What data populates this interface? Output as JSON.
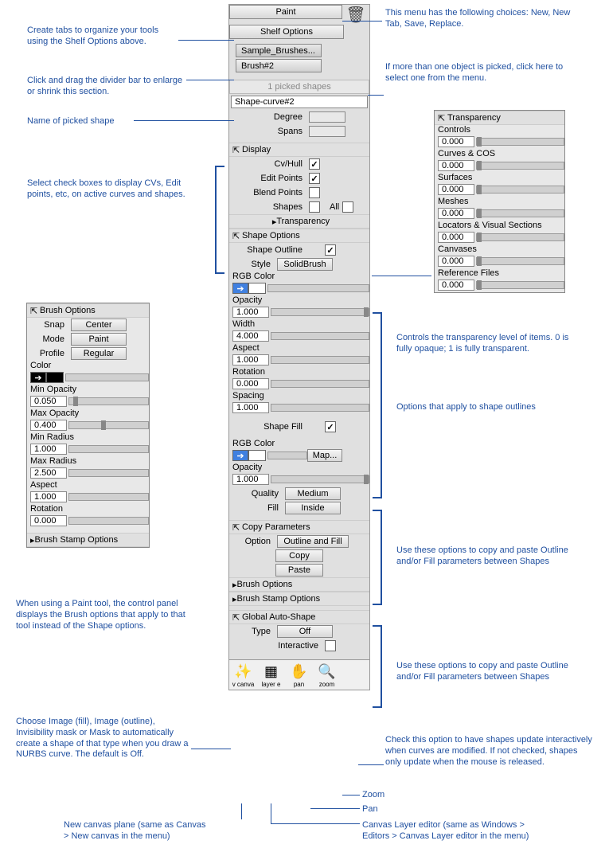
{
  "header": {
    "paint": "Paint",
    "shelf_options": "Shelf Options"
  },
  "tabs": {
    "sample_brushes": "Sample_Brushes...",
    "brush2": "Brush#2"
  },
  "picked": {
    "count_label": "1 picked shapes",
    "shape_name": "Shape-curve#2",
    "degree_label": "Degree",
    "spans_label": "Spans"
  },
  "display": {
    "header": "Display",
    "cv_hull": "Cv/Hull",
    "edit_points": "Edit Points",
    "blend_points": "Blend Points",
    "shapes": "Shapes",
    "all": "All",
    "transparency": "Transparency"
  },
  "shape_options": {
    "header": "Shape Options",
    "shape_outline": "Shape Outline",
    "style": "Style",
    "style_val": "SolidBrush",
    "rgb_color": "RGB Color",
    "opacity": "Opacity",
    "opacity_val": "1.000",
    "width": "Width",
    "width_val": "4.000",
    "aspect": "Aspect",
    "aspect_val": "1.000",
    "rotation": "Rotation",
    "rotation_val": "0.000",
    "spacing": "Spacing",
    "spacing_val": "1.000",
    "shape_fill": "Shape Fill",
    "rgb_color2": "RGB Color",
    "map": "Map...",
    "opacity2": "Opacity",
    "opacity2_val": "1.000",
    "quality": "Quality",
    "quality_val": "Medium",
    "fill": "Fill",
    "fill_val": "Inside"
  },
  "copy_params": {
    "header": "Copy Parameters",
    "option": "Option",
    "option_val": "Outline and Fill",
    "copy": "Copy",
    "paste": "Paste",
    "brush_options": "Brush Options",
    "brush_stamp": "Brush Stamp Options"
  },
  "global_auto": {
    "header": "Global Auto-Shape",
    "type": "Type",
    "type_val": "Off",
    "interactive": "Interactive"
  },
  "toolbar": {
    "canvas": "v canva",
    "layer": "layer e",
    "pan": "pan",
    "zoom": "zoom"
  },
  "brush_panel": {
    "header": "Brush Options",
    "snap": "Snap",
    "snap_val": "Center",
    "mode": "Mode",
    "mode_val": "Paint",
    "profile": "Profile",
    "profile_val": "Regular",
    "color": "Color",
    "min_opacity": "Min Opacity",
    "min_opacity_val": "0.050",
    "max_opacity": "Max Opacity",
    "max_opacity_val": "0.400",
    "min_radius": "Min Radius",
    "min_radius_val": "1.000",
    "max_radius": "Max Radius",
    "max_radius_val": "2.500",
    "aspect": "Aspect",
    "aspect_val": "1.000",
    "rotation": "Rotation",
    "rotation_val": "0.000",
    "brush_stamp": "Brush Stamp Options"
  },
  "transparency_panel": {
    "header": "Transparency",
    "controls": "Controls",
    "curves_cos": "Curves & COS",
    "surfaces": "Surfaces",
    "meshes": "Meshes",
    "locators": "Locators & Visual Sections",
    "canvases": "Canvases",
    "reference_files": "Reference Files",
    "val": "0.000"
  },
  "annotations": {
    "a1": "Create tabs to organize your tools using the Shelf Options above.",
    "a2": "Click and drag the divider bar to enlarge or shrink this section.",
    "a3": "Name of picked shape",
    "a4": "Select check boxes to display CVs, Edit points, etc, on active curves and shapes.",
    "a5": "When using a Paint tool, the control panel displays the Brush options that apply to that tool instead of the Shape options.",
    "a6": "Choose Image (fill), Image (outline), Invisibility mask or Mask to automatically create a shape of that type when you draw a NURBS curve. The default is Off.",
    "a7": "New canvas plane (same as Canvas > New canvas in the menu)",
    "a8": "This menu has the following choices: New, New Tab, Save, Replace.",
    "a9": "If more than one object is picked, click here to select one from the menu.",
    "a10": "Controls the transparency level of items. 0 is fully opaque; 1 is fully transparent.",
    "a11": "Options that apply to shape outlines",
    "a12": "Use these options to copy and paste Outline and/or Fill parameters between Shapes",
    "a13": "Use these options to copy and paste Outline and/or Fill parameters between Shapes",
    "a14": "Check this option to have shapes update interactively when curves are modified. If not checked, shapes only update when the mouse is released.",
    "a15": "Zoom",
    "a16": "Pan",
    "a17": "Canvas Layer editor (same as Windows > Editors > Canvas Layer editor in the menu)"
  }
}
